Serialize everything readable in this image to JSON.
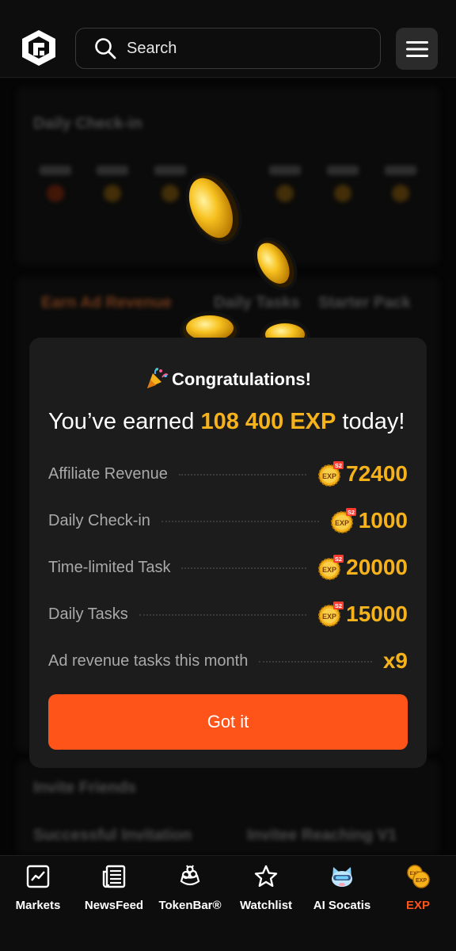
{
  "header": {
    "search_placeholder": "Search"
  },
  "background": {
    "checkin_title": "Daily Check-in",
    "tab_ad_revenue": "Earn Ad Revenue",
    "tab_daily_tasks": "Daily Tasks",
    "tab_starter_pack": "Starter Pack",
    "invite_title": "Invite Friends",
    "successful_invitation": "Successful Invitation",
    "invitee_reaching": "Invitee Reaching V1"
  },
  "modal": {
    "title": "Congratulations!",
    "earned_prefix": "You’ve earned ",
    "earned_amount": "108 400 EXP",
    "earned_suffix": " today!",
    "rows": [
      {
        "label": "Affiliate Revenue",
        "value": "72400",
        "has_badge": true
      },
      {
        "label": "Daily Check-in",
        "value": "1000",
        "has_badge": true
      },
      {
        "label": "Time-limited Task",
        "value": "20000",
        "has_badge": true
      },
      {
        "label": "Daily Tasks",
        "value": "15000",
        "has_badge": true
      },
      {
        "label": "Ad revenue tasks this month",
        "value": "x9",
        "has_badge": false
      }
    ],
    "badge_text": "EXP",
    "badge_season": "S2",
    "button_label": "Got it"
  },
  "bottom_nav": {
    "items": [
      {
        "label": "Markets",
        "icon": "markets-chart-icon"
      },
      {
        "label": "NewsFeed",
        "icon": "newsfeed-icon"
      },
      {
        "label": "TokenBar®",
        "icon": "tokenbar-icon"
      },
      {
        "label": "Watchlist",
        "icon": "star-icon"
      },
      {
        "label": "AI Socatis",
        "icon": "ai-cat-icon"
      },
      {
        "label": "EXP",
        "icon": "exp-coins-icon",
        "active": true
      }
    ]
  },
  "colors": {
    "accent": "#ff5419",
    "gold": "#f6b21b",
    "modal_bg": "#1c1c1c"
  }
}
